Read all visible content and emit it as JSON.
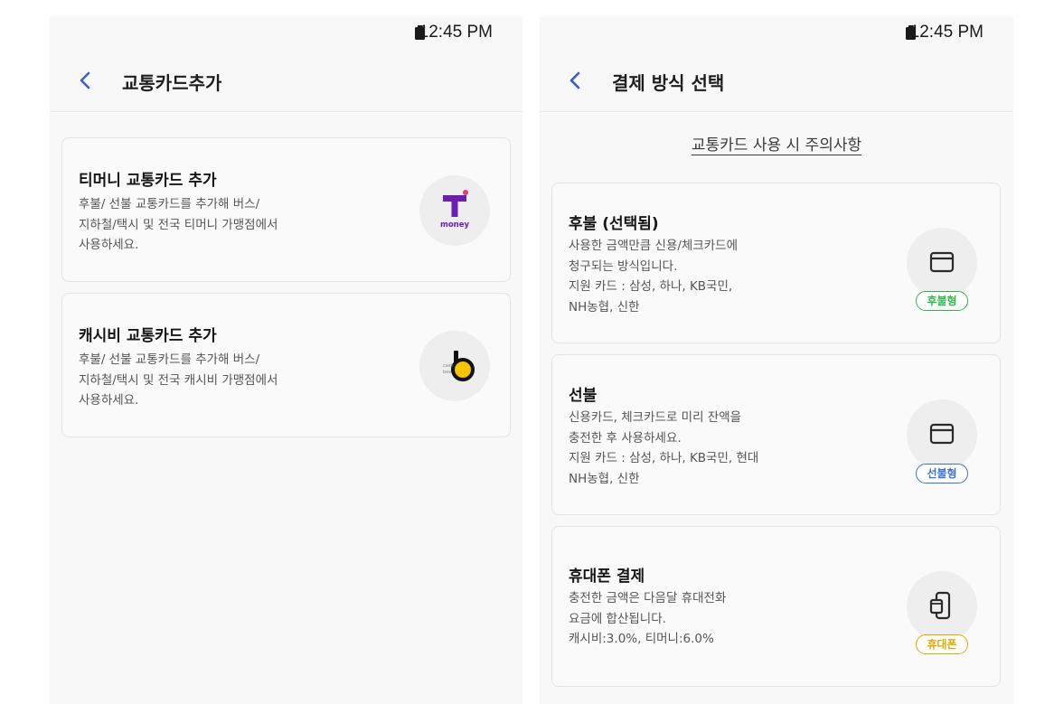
{
  "left_screen": {
    "status_time": "12:45 PM",
    "title": "교통카드추가",
    "cards": [
      {
        "title": "티머니 교통카드 추가",
        "description": "후불/ 선불 교통카드를 추가해 버스/\n지하철/택시 및 전국 티머니 가맹점에서\n사용하세요.",
        "logo_letter": "T",
        "logo_text": "money",
        "logo_color": "#6b1fb1"
      },
      {
        "title": "캐시비 교통카드 추가",
        "description": "후불/ 선불 교통카드를 추가해 버스/\n지하철/택시 및 전국 캐시비 가맹점에서\n사용하세요.",
        "logo_letter": "b",
        "logo_text": "cash bee",
        "logo_color": "#f7c400"
      }
    ]
  },
  "right_screen": {
    "status_time": "12:45 PM",
    "title": "결제 방식 선택",
    "notice_link": "교통카드 사용 시 주의사항",
    "options": [
      {
        "title": "후불 (선택됨)",
        "description": "사용한 금액만큼 신용/체크카드에\n청구되는 방식입니다.\n지원 카드 : 삼성, 하나, KB국민,\nNH농협, 신한",
        "badge": "후불형",
        "badge_color": "#2fb84a",
        "icon": "card-icon"
      },
      {
        "title": "선불",
        "description": "신용카드, 체크카드로 미리 잔액을\n충전한 후 사용하세요.\n지원 카드 : 삼성, 하나, KB국민, 현대\nNH농협, 신한",
        "badge": "선불형",
        "badge_color": "#3b73d9",
        "icon": "card-icon"
      },
      {
        "title": "휴대폰 결제",
        "description": "충전한 금액은 다음달 휴대전화\n요금에 합산됩니다.\n캐시비:3.0%, 티머니:6.0%",
        "badge": "휴대폰",
        "badge_color": "#e8a800",
        "icon": "phone-payment-icon"
      }
    ]
  }
}
